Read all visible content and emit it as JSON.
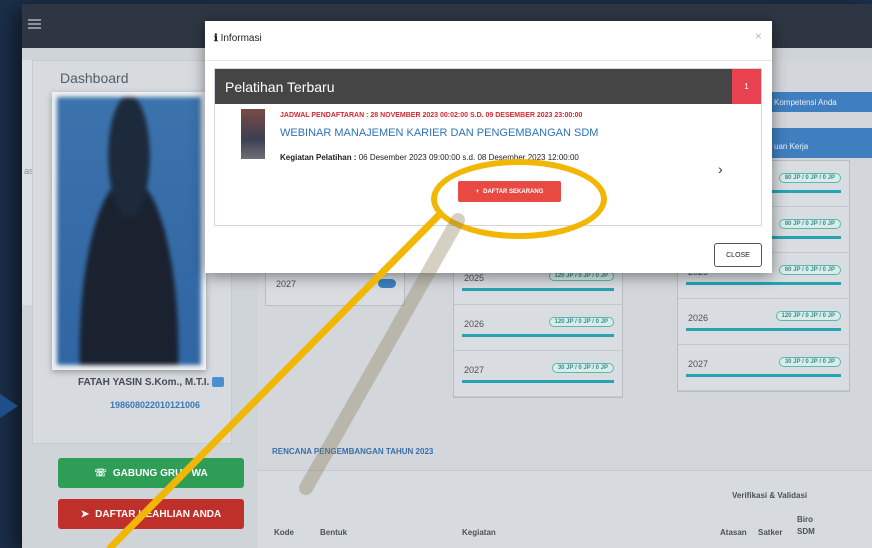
{
  "app": {
    "dashboard_title": "Dashboard",
    "sidebar_fragment": "asi"
  },
  "profile": {
    "name": "FATAH YASIN S.Kom., M.T.I.",
    "nip": "198608022010121006",
    "gabung_label": "GABUNG GRUP WA",
    "keahlian_label": "DAFTAR KEAHLIAN ANDA"
  },
  "right_tabs": {
    "kompetensi": "Kompetensi Anda",
    "satuan": "uan Kerja"
  },
  "jp_grid": {
    "left_rows": [
      {
        "year": "2025",
        "jp": "120 JP / 0 JP / 0 JP"
      },
      {
        "year": "2026",
        "jp": "120 JP / 0 JP / 0 JP"
      },
      {
        "year": "2027",
        "jp": "30 JP / 0 JP / 0 JP"
      }
    ],
    "right_rows": [
      {
        "year": "",
        "jp": "80 JP / 0 JP / 0 JP"
      },
      {
        "year": "",
        "jp": "80 JP / 0 JP / 0 JP"
      },
      {
        "year": "2025",
        "jp": "60 JP / 0 JP / 0 JP"
      },
      {
        "year": "2026",
        "jp": "120 JP / 0 JP / 0 JP"
      },
      {
        "year": "2027",
        "jp": "30 JP / 0 JP / 0 JP"
      }
    ],
    "small_year": "2027"
  },
  "rencana": {
    "title": "RENCANA PENGEMBANGAN TAHUN 2023",
    "group_header": "Verifikasi & Validasi",
    "columns": [
      "Kode",
      "Bentuk",
      "Kegiatan",
      "Atasan",
      "Satker",
      "Biro SDM"
    ]
  },
  "modal": {
    "title": "Informasi",
    "panel_title": "Pelatihan Terbaru",
    "badge": "1",
    "schedule": "JADWAL PENDAFTARAN : 28 NOVEMBER 2023 00:02:00 S.D. 09 DESEMBER 2023 23:00:00",
    "event_title": "WEBINAR MANAJEMEN KARIER DAN PENGEMBANGAN SDM",
    "meta_label": "Kegiatan Pelatihan :",
    "meta_value": "06 Desember 2023 09:00:00 s.d. 08 Desember 2023 12:00:00",
    "register_label": "DAFTAR SEKARANG",
    "close_label": "CLOSE"
  },
  "colors": {
    "accent_yellow": "#f2b705",
    "register_red": "#e84a43",
    "wa_green": "#2e9e56",
    "keahlian_red": "#c0302b",
    "panel_dark": "#454545",
    "link_blue": "#2d73b5"
  }
}
